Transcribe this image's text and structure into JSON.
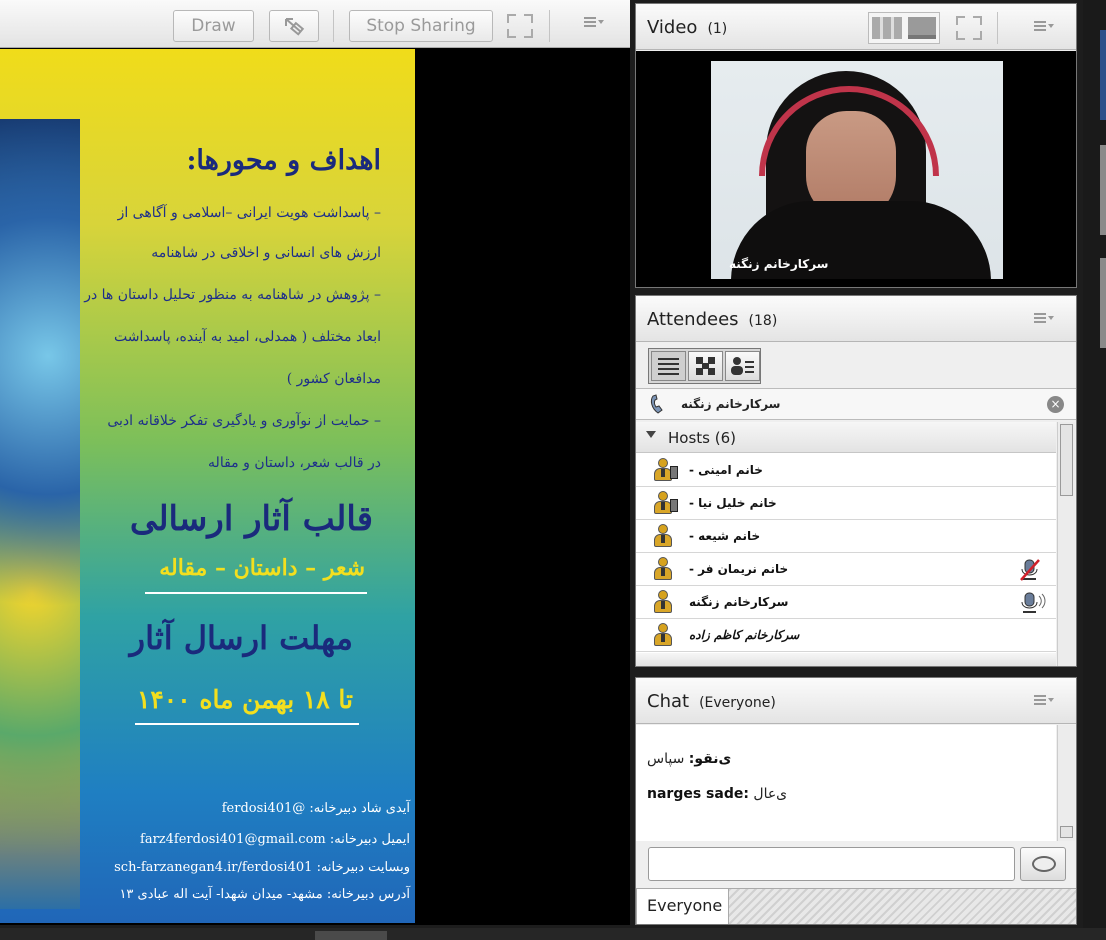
{
  "share_toolbar": {
    "draw_label": "Draw",
    "stop_sharing_label": "Stop Sharing"
  },
  "poster": {
    "heading": "اهداف و محورها:",
    "lines": [
      "– پاسداشت هویت ایرانی –اسلامی و آگاهی از",
      "ارزش های انسانی و اخلاقی در شاهنامه",
      "– پژوهش در شاهنامه به منظور تحلیل داستان ها در",
      "ابعاد مختلف ( همدلی، امید به آینده، پاسداشت",
      "مدافعان کشور )",
      "– حمایت از نوآوری و یادگیری تفکر خلاقانه ادبی",
      "در قالب شعر، داستان و مقاله"
    ],
    "format_title": "قالب آثار ارسالی",
    "format_items": "شعر – داستان – مقاله",
    "deadline_title": "مهلت ارسال آثار",
    "deadline_date": "تا ۱۸ بهمن ماه ۱۴۰۰",
    "footer": [
      {
        "label": "آیدی شاد دبیرخانه:",
        "value": "@ferdosi401"
      },
      {
        "label": "ایمیل دبیرخانه:",
        "value": "farz4ferdosi401@gmail.com"
      },
      {
        "label": "وبسایت دبیرخانه:",
        "value": "sch-farzanegan4.ir/ferdosi401"
      },
      {
        "label": "آدرس دبیرخانه:",
        "value": "مشهد- میدان شهدا- آیت اله عبادی ۱۳"
      }
    ]
  },
  "video": {
    "title": "Video",
    "count": "(1)",
    "camera_name": "سرکارخانم زنگنه"
  },
  "attendees": {
    "title": "Attendees",
    "count": "(18)",
    "active_speaker": "سرکارخانم زنگنه",
    "hosts_label": "Hosts (6)",
    "hosts": [
      {
        "name": "خانم امینی -",
        "icon": "host-phone-icon",
        "status": ""
      },
      {
        "name": "خانم خلیل نیا -",
        "icon": "host-phone-icon",
        "status": ""
      },
      {
        "name": "خانم شیعه -",
        "icon": "host-icon",
        "status": ""
      },
      {
        "name": "خانم نریمان فر -",
        "icon": "host-icon",
        "status": "mic-muted-icon"
      },
      {
        "name": "سرکارخانم زنگنه",
        "icon": "host-icon",
        "status": "mic-speaking-icon"
      },
      {
        "name": "سرکارخانم کاظم زاده",
        "icon": "host-icon",
        "status": ""
      }
    ]
  },
  "chat": {
    "title": "Chat",
    "scope": "(Everyone)",
    "messages": [
      {
        "sender": "ی‌نقو:",
        "text": "سپاس"
      },
      {
        "sender": "narges sade:",
        "text": "ی‌عال"
      }
    ],
    "input_placeholder": "",
    "recipient_tab": "Everyone"
  },
  "colors": {
    "pod_bg": "#efefef",
    "poster_text": "#1e2f8a",
    "muted_red": "#d0202a"
  }
}
